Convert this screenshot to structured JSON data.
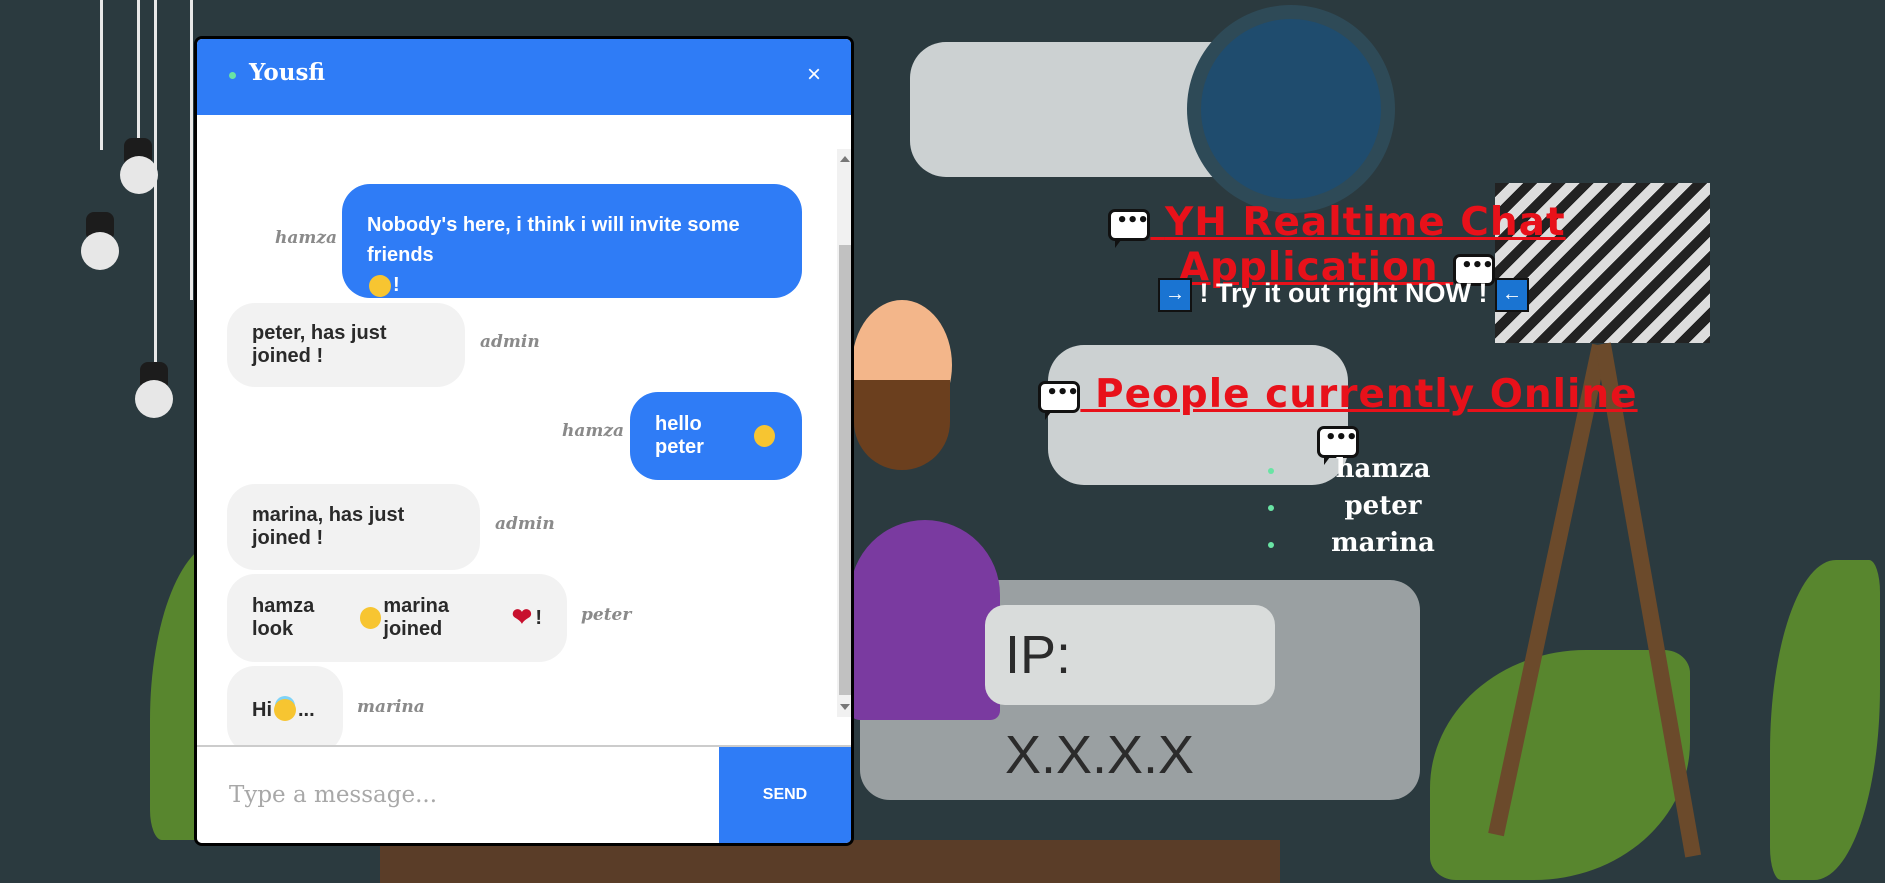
{
  "chat": {
    "user": "Yousfi",
    "close_label": "×",
    "messages": [
      {
        "sender": "hamza",
        "text": "Nobody's here, i think i will invite some friends",
        "suffix": "!",
        "emoji": "wink",
        "own": true
      },
      {
        "sender": "admin",
        "text": "peter, has just joined !",
        "own": false
      },
      {
        "sender": "hamza",
        "text": "hello peter",
        "emoji": "smile",
        "own": true
      },
      {
        "sender": "admin",
        "text": "marina, has just joined !",
        "own": false
      },
      {
        "sender": "peter",
        "text_a": "hamza look",
        "text_b": "marina joined",
        "suffix": "!",
        "own": false
      },
      {
        "sender": "marina",
        "text": "Hi",
        "suffix": "...",
        "emoji": "innocent",
        "own": false
      }
    ],
    "input_placeholder": "Type a message...",
    "send_label": "SEND"
  },
  "app": {
    "title": "YH Realtime Chat Application",
    "tagline": "! Try it out right NOW !",
    "arrow_right": "→",
    "arrow_left": "←",
    "online_title": "People currently Online",
    "online_users": [
      "hamza",
      "peter",
      "marina"
    ]
  },
  "background": {
    "ip_label": "IP: X.X.X.X"
  },
  "colors": {
    "accent_blue": "#2f7cf6",
    "title_red": "#e8111a",
    "online_green": "#69e4a4",
    "page_bg": "#2b3a3f"
  }
}
